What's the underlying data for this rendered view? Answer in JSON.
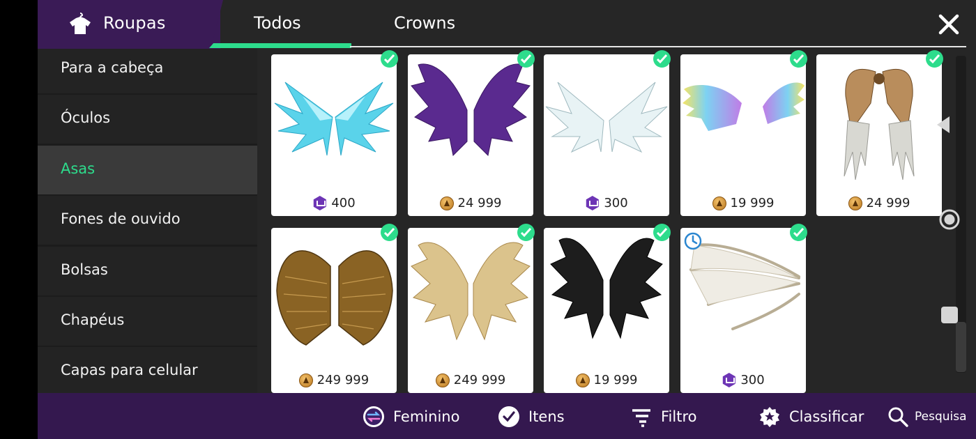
{
  "header": {
    "title": "Roupas",
    "brand_icon": "shirt-icon",
    "tabs": [
      {
        "label": "Todos",
        "active": true
      },
      {
        "label": "Crowns",
        "active": false
      }
    ],
    "accent_color": "#2ddc8c",
    "brand_color": "#3a1b56"
  },
  "sidebar": {
    "items": [
      {
        "label": "Para a cabeça",
        "active": false
      },
      {
        "label": "Óculos",
        "active": false
      },
      {
        "label": "Asas",
        "active": true
      },
      {
        "label": "Fones de ouvido",
        "active": false
      },
      {
        "label": "Bolsas",
        "active": false
      },
      {
        "label": "Chapéus",
        "active": false
      },
      {
        "label": "Capas para celular",
        "active": false
      }
    ]
  },
  "items": [
    {
      "price": "400",
      "currency": "crown-gem",
      "owned": true,
      "art": "ice-blue-wings"
    },
    {
      "price": "24 999",
      "currency": "coin",
      "owned": true,
      "art": "purple-feather-wings"
    },
    {
      "price": "300",
      "currency": "crown-gem",
      "owned": true,
      "art": "white-ice-wings"
    },
    {
      "price": "19 999",
      "currency": "coin",
      "owned": true,
      "art": "rainbow-wings"
    },
    {
      "price": "24 999",
      "currency": "coin",
      "owned": true,
      "art": "steampunk-wings"
    },
    {
      "price": "249 999",
      "currency": "coin",
      "owned": true,
      "art": "golden-wings"
    },
    {
      "price": "249 999",
      "currency": "coin",
      "owned": true,
      "art": "beige-feather-wings"
    },
    {
      "price": "19 999",
      "currency": "coin",
      "owned": true,
      "art": "black-feather-wings"
    },
    {
      "price": "300",
      "currency": "crown-gem",
      "owned": true,
      "limited_time": true,
      "art": "bone-wings"
    }
  ],
  "bottom_bar": {
    "gender_label": "Feminino",
    "items_label": "Itens",
    "filter_label": "Filtro",
    "sort_label": "Classificar",
    "search_label": "Pesquisa",
    "bar_color": "#34184f"
  }
}
